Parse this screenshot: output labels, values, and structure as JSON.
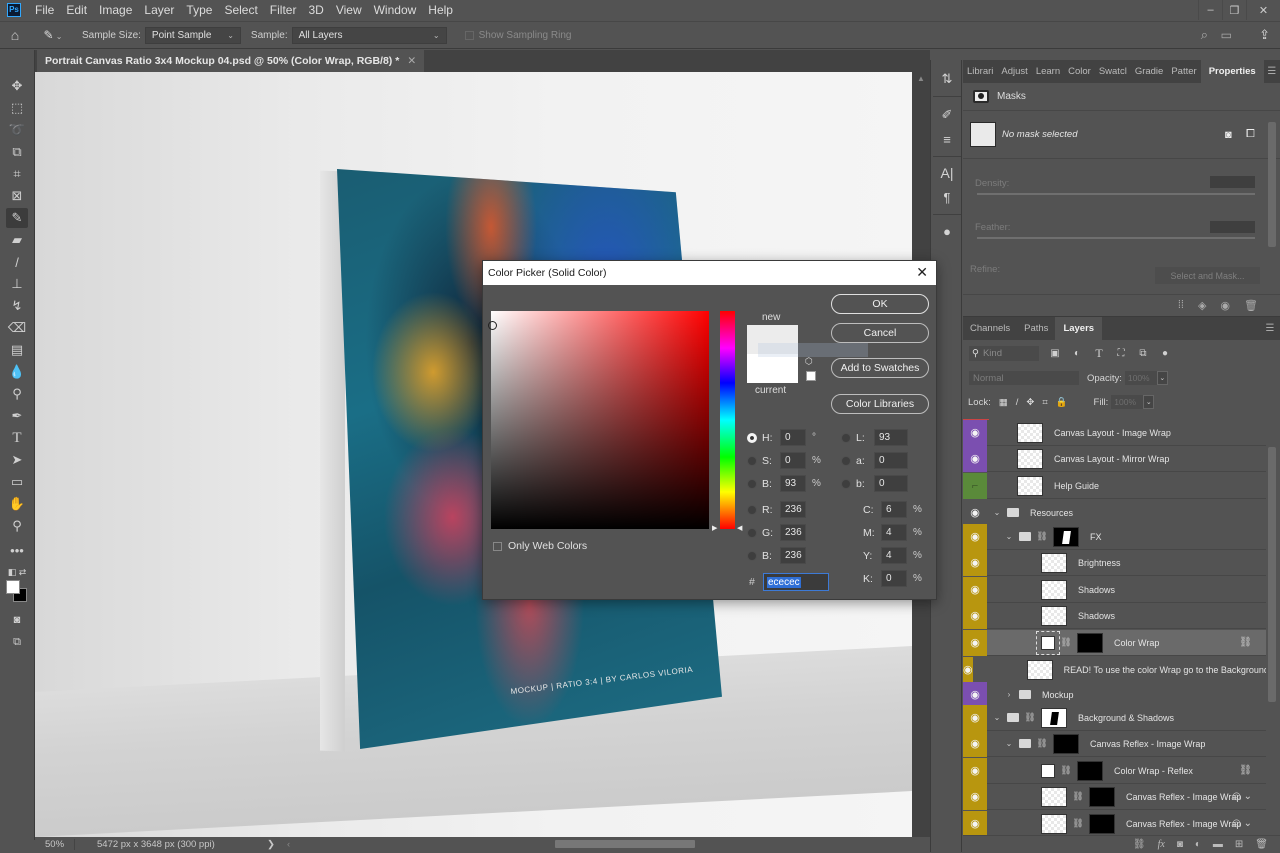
{
  "app": {
    "logo": "Ps"
  },
  "menu": [
    "File",
    "Edit",
    "Image",
    "Layer",
    "Type",
    "Select",
    "Filter",
    "3D",
    "View",
    "Window",
    "Help"
  ],
  "window_controls": {
    "minimize": "–",
    "restore": "❐",
    "close": "✕"
  },
  "options_bar": {
    "sample_size_label": "Sample Size:",
    "sample_size_value": "Point Sample",
    "sample_label": "Sample:",
    "sample_value": "All Layers",
    "show_sampling_ring": "Show Sampling Ring"
  },
  "document": {
    "tab_title": "Portrait Canvas Ratio 3x4 Mockup 04.psd @ 50% (Color Wrap, RGB/8) *",
    "canvas_caption": "MOCKUP | RATIO 3:4 | BY CARLOS VILORIA"
  },
  "status_bar": {
    "zoom": "50%",
    "dimensions": "5472 px x 3648 px (300 ppi)",
    "arrow": "❯",
    "back": "‹"
  },
  "tools": [
    "move-tool",
    "marquee-tool",
    "lasso-tool",
    "object-select-tool",
    "crop-tool",
    "frame-tool",
    "eyedropper-tool",
    "healing-tool",
    "brush-tool",
    "stamp-tool",
    "history-brush-tool",
    "eraser-tool",
    "gradient-tool",
    "blur-tool",
    "dodge-tool",
    "pen-tool",
    "type-tool",
    "path-select-tool",
    "rectangle-tool",
    "hand-tool",
    "zoom-tool",
    "more-tools"
  ],
  "properties_panel": {
    "tabs": [
      "Librari",
      "Adjust",
      "Learn",
      "Color",
      "Swatcl",
      "Gradie",
      "Patter",
      "Properties"
    ],
    "active_tab": "Properties",
    "section": "Masks",
    "no_mask": "No mask selected",
    "density_label": "Density:",
    "feather_label": "Feather:",
    "refine_label": "Refine:",
    "select_and_mask": "Select and Mask..."
  },
  "layers_panel": {
    "tabs": [
      "Channels",
      "Paths",
      "Layers"
    ],
    "active_tab": "Layers",
    "kind_placeholder": "Kind",
    "blend_mode": "Normal",
    "opacity_label": "Opacity:",
    "opacity_value": "100%",
    "lock_label": "Lock:",
    "fill_label": "Fill:",
    "fill_value": "100%",
    "layers": [
      {
        "name": "Canvas Layout - Image Wrap",
        "color": "#7b4fb0",
        "visible": true,
        "indent": 0,
        "type": "smart"
      },
      {
        "name": "Canvas Layout - Mirror Wrap",
        "color": "#7b4fb0",
        "visible": true,
        "indent": 0,
        "type": "smart"
      },
      {
        "name": "Help Guide",
        "color": "#5a8a3a",
        "visible": false,
        "indent": 0,
        "type": "pixel"
      },
      {
        "name": "Resources",
        "color": "",
        "visible": true,
        "indent": 0,
        "type": "group",
        "expanded": true
      },
      {
        "name": "FX",
        "color": "#b8960f",
        "visible": true,
        "indent": 1,
        "type": "group-mask",
        "expanded": true
      },
      {
        "name": "Brightness",
        "color": "#b8960f",
        "visible": true,
        "indent": 2,
        "type": "pixel"
      },
      {
        "name": "Shadows",
        "color": "#b8960f",
        "visible": true,
        "indent": 2,
        "type": "pixel"
      },
      {
        "name": "Shadows",
        "color": "#b8960f",
        "visible": true,
        "indent": 2,
        "type": "pixel"
      },
      {
        "name": "Color Wrap",
        "color": "#b8960f",
        "visible": true,
        "indent": 2,
        "type": "fill-mask",
        "selected": true,
        "linked": true
      },
      {
        "name": "READ! To use the color Wrap go to the Background",
        "color": "#b8960f",
        "visible": true,
        "indent": 2,
        "type": "pixel"
      },
      {
        "name": "Mockup",
        "color": "#7b4fb0",
        "visible": true,
        "indent": 1,
        "type": "group",
        "expanded": false
      },
      {
        "name": "Background & Shadows",
        "color": "#b8960f",
        "visible": true,
        "indent": 0,
        "type": "group-mask",
        "expanded": true
      },
      {
        "name": "Canvas Reflex - Image Wrap",
        "color": "#b8960f",
        "visible": true,
        "indent": 1,
        "type": "group-mask",
        "expanded": true
      },
      {
        "name": "Color Wrap - Reflex",
        "color": "#b8960f",
        "visible": true,
        "indent": 2,
        "type": "fill-mask",
        "linked": true
      },
      {
        "name": "Canvas Reflex - Image Wrap",
        "color": "#b8960f",
        "visible": true,
        "indent": 2,
        "type": "smart-mask",
        "effects": true
      },
      {
        "name": "Canvas Reflex - Image Wrap",
        "color": "#b8960f",
        "visible": true,
        "indent": 2,
        "type": "smart-mask",
        "effects": true
      }
    ]
  },
  "color_picker": {
    "title": "Color Picker (Solid Color)",
    "ok": "OK",
    "cancel": "Cancel",
    "add_to_swatches": "Add to Swatches",
    "color_libraries": "Color Libraries",
    "new_label": "new",
    "current_label": "current",
    "new_color": "#ececec",
    "current_color": "#ffffff",
    "only_web_colors": "Only Web Colors",
    "selected_mode": "H",
    "fields": {
      "H": "0",
      "S": "0",
      "B": "93",
      "R": "236",
      "G": "236",
      "B2": "236",
      "L": "93",
      "a": "0",
      "b": "0",
      "C": "6",
      "M": "4",
      "Y": "4",
      "K": "0"
    },
    "units": {
      "deg": "°",
      "pct": "%"
    },
    "hex": "ececec"
  }
}
